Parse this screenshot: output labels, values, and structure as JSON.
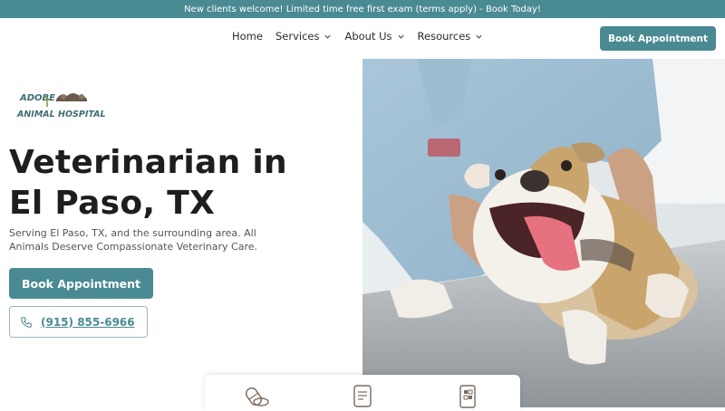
{
  "banner": {
    "text": "New clients welcome! Limited time free first exam (terms apply) - Book Today!"
  },
  "nav": {
    "items": [
      {
        "label": "Home",
        "has_dropdown": false
      },
      {
        "label": "Services",
        "has_dropdown": true
      },
      {
        "label": "About Us",
        "has_dropdown": true
      },
      {
        "label": "Resources",
        "has_dropdown": true
      }
    ],
    "book_label": "Book Appointment"
  },
  "logo": {
    "line1": "ADOBE",
    "line2": "ANIMAL HOSPITAL"
  },
  "hero": {
    "title_line1": "Veterinarian in",
    "title_line2": "El Paso, TX",
    "subtitle": "Serving El Paso, TX, and the surrounding area. All Animals Deserve Compassionate Veterinary Care.",
    "book_label": "Book Appointment",
    "phone": "(915) 855-6966"
  },
  "service_cards": [
    {
      "icon": "pills-icon"
    },
    {
      "icon": "clipboard-icon"
    },
    {
      "icon": "id-card-icon"
    }
  ],
  "colors": {
    "accent": "#4a8a93",
    "text": "#1e1e1e",
    "banner_text": "#ffffff"
  }
}
